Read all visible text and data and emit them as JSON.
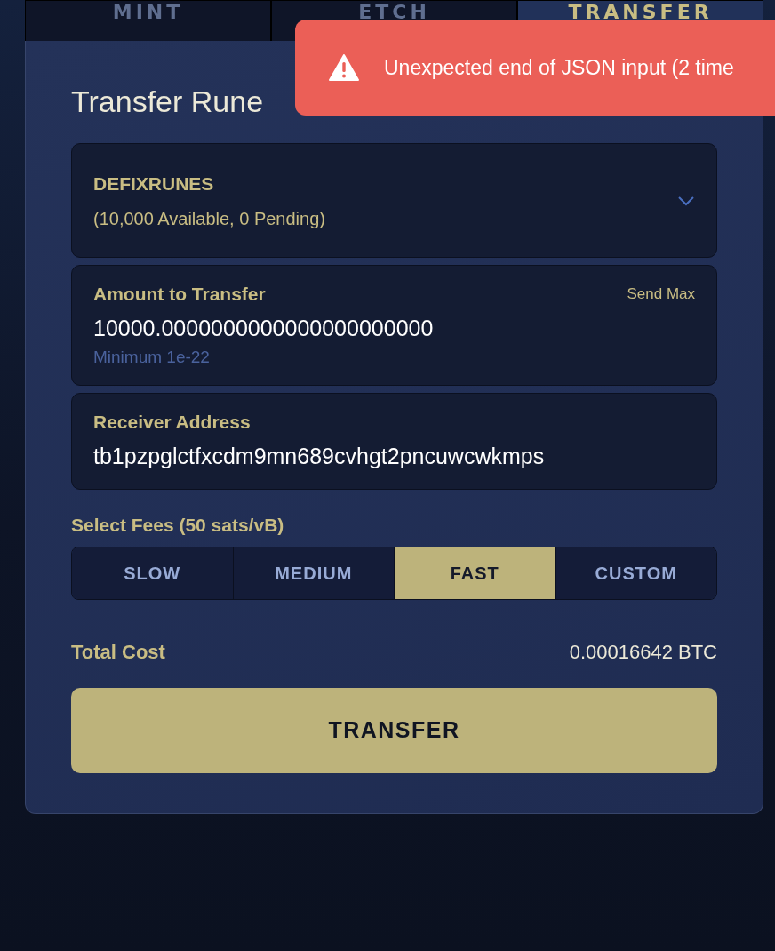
{
  "tabs": [
    {
      "label": "MINT",
      "selected": false
    },
    {
      "label": "ETCH",
      "selected": false
    },
    {
      "label": "TRANSFER",
      "selected": true
    }
  ],
  "toast": {
    "kind": "error",
    "message": "Unexpected end of JSON input (2 time"
  },
  "title": "Transfer Rune",
  "rune_select": {
    "name": "DEFIXRUNES",
    "balance": "(10,000 Available, 0 Pending)"
  },
  "amount": {
    "label": "Amount to Transfer",
    "send_max": "Send Max",
    "value": "10000.0000000000000000000000",
    "hint": "Minimum 1e-22"
  },
  "receiver": {
    "label": "Receiver Address",
    "value": "tb1pzpglctfxcdm9mn689cvhgt2pncuwcwkmps"
  },
  "fees": {
    "label": "Select Fees (50 sats/vB)",
    "options": [
      {
        "label": "SLOW",
        "selected": false
      },
      {
        "label": "MEDIUM",
        "selected": false
      },
      {
        "label": "FAST",
        "selected": true
      },
      {
        "label": "CUSTOM",
        "selected": false
      }
    ]
  },
  "total": {
    "label": "Total Cost",
    "value": "0.00016642 BTC"
  },
  "submit": "TRANSFER"
}
